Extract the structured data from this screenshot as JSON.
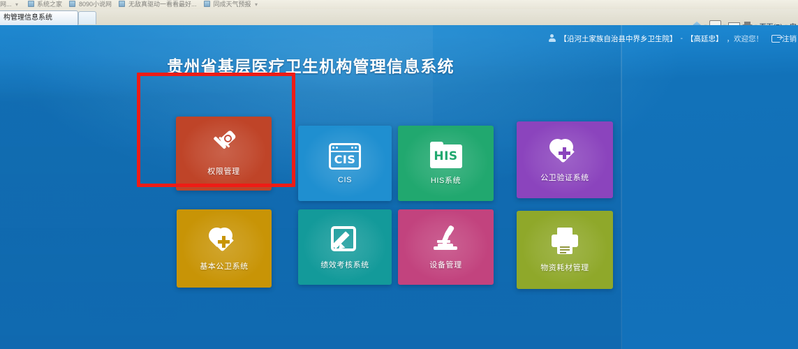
{
  "browser": {
    "favorites": [
      {
        "label": "网...",
        "has_caret": true,
        "has_icon": false
      },
      {
        "label": "系统之家",
        "has_caret": false,
        "has_icon": true
      },
      {
        "label": "8090小说网",
        "has_caret": false,
        "has_icon": true
      },
      {
        "label": "无敌真驱动一看看最好...",
        "has_caret": false,
        "has_icon": true
      },
      {
        "label": "同成天气预报",
        "has_caret": true,
        "has_icon": true
      }
    ],
    "tab_title": "构管理信息系统",
    "toolbar": {
      "home_icon": "home-icon",
      "feeds_icon": "rss-icon",
      "mail_icon": "mail-icon",
      "print_icon": "printer-icon",
      "page_menu_label": "页面(P)",
      "safety_menu_label": "安"
    }
  },
  "app": {
    "title": "贵州省基层医疗卫生机构管理信息系统",
    "userbar": {
      "user_icon": "user-icon",
      "org_name": "【沿河土家族自治县中界乡卫生院】",
      "separator": "-",
      "user_name": "【高廷忠】",
      "greeting": "，欢迎您！",
      "logout_icon": "logout-icon",
      "logout_label": "注销"
    },
    "tiles": [
      {
        "id": "permission",
        "label": "权限管理",
        "icon": "key-icon",
        "color": "#bf4428",
        "row": 0,
        "col": 0,
        "highlighted": true
      },
      {
        "id": "cis",
        "label": "CIS",
        "icon": "cis-window-icon",
        "color": "#1f8fd0",
        "row": 0,
        "col": 1,
        "highlighted": false
      },
      {
        "id": "his",
        "label": "HIS系统",
        "icon": "his-folder-icon",
        "color": "#21a86f",
        "row": 0,
        "col": 2,
        "highlighted": false
      },
      {
        "id": "pubverify",
        "label": "公卫验证系统",
        "icon": "heart-cross-icon",
        "color": "#8b44bd",
        "row": 0,
        "col": 3,
        "highlighted": false
      },
      {
        "id": "basicpub",
        "label": "基本公卫系统",
        "icon": "heart-cross-icon",
        "color": "#c89406",
        "row": 1,
        "col": 0,
        "highlighted": false
      },
      {
        "id": "performance",
        "label": "绩效考核系统",
        "icon": "edit-square-icon",
        "color": "#139a9a",
        "row": 1,
        "col": 1,
        "highlighted": false
      },
      {
        "id": "equipment",
        "label": "设备管理",
        "icon": "microscope-icon",
        "color": "#c2437e",
        "row": 1,
        "col": 2,
        "highlighted": false
      },
      {
        "id": "materials",
        "label": "物资耗材管理",
        "icon": "printer-icon",
        "color": "#8fa82a",
        "row": 1,
        "col": 3,
        "highlighted": false
      }
    ],
    "highlight_color": "#ee1c16",
    "background_color": "#1171bd"
  }
}
